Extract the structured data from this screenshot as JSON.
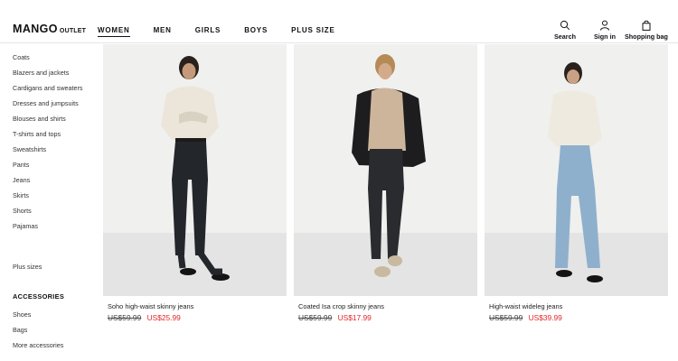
{
  "brand": {
    "name": "MANGO",
    "suffix": "OUTLET"
  },
  "nav": [
    {
      "label": "WOMEN",
      "active": true
    },
    {
      "label": "MEN",
      "active": false
    },
    {
      "label": "GIRLS",
      "active": false
    },
    {
      "label": "BOYS",
      "active": false
    },
    {
      "label": "PLUS SIZE",
      "active": false
    }
  ],
  "utilities": {
    "search": {
      "label": "Search",
      "icon": "search-icon"
    },
    "signin": {
      "label": "Sign in",
      "icon": "user-icon"
    },
    "bag": {
      "label": "Shopping bag",
      "icon": "bag-icon"
    }
  },
  "sidebar": {
    "categories": [
      "Coats",
      "Blazers and jackets",
      "Cardigans and sweaters",
      "Dresses and jumpsuits",
      "Blouses and shirts",
      "T-shirts and tops",
      "Sweatshirts",
      "Pants",
      "Jeans",
      "Skirts",
      "Shorts",
      "Pajamas"
    ],
    "plus": "Plus sizes",
    "accessories_heading": "ACCESSORIES",
    "accessories": [
      "Shoes",
      "Bags",
      "More accessories"
    ]
  },
  "products": [
    {
      "name": "Soho high-waist skinny jeans",
      "old_price": "US$59.99",
      "new_price": "US$25.99"
    },
    {
      "name": "Coated Isa crop skinny jeans",
      "old_price": "US$59.99",
      "new_price": "US$17.99"
    },
    {
      "name": "High-waist wideleg jeans",
      "old_price": "US$59.99",
      "new_price": "US$39.99"
    }
  ],
  "colors": {
    "sale": "#e2262a",
    "text": "#111111",
    "photo_bg": "#ececec"
  }
}
